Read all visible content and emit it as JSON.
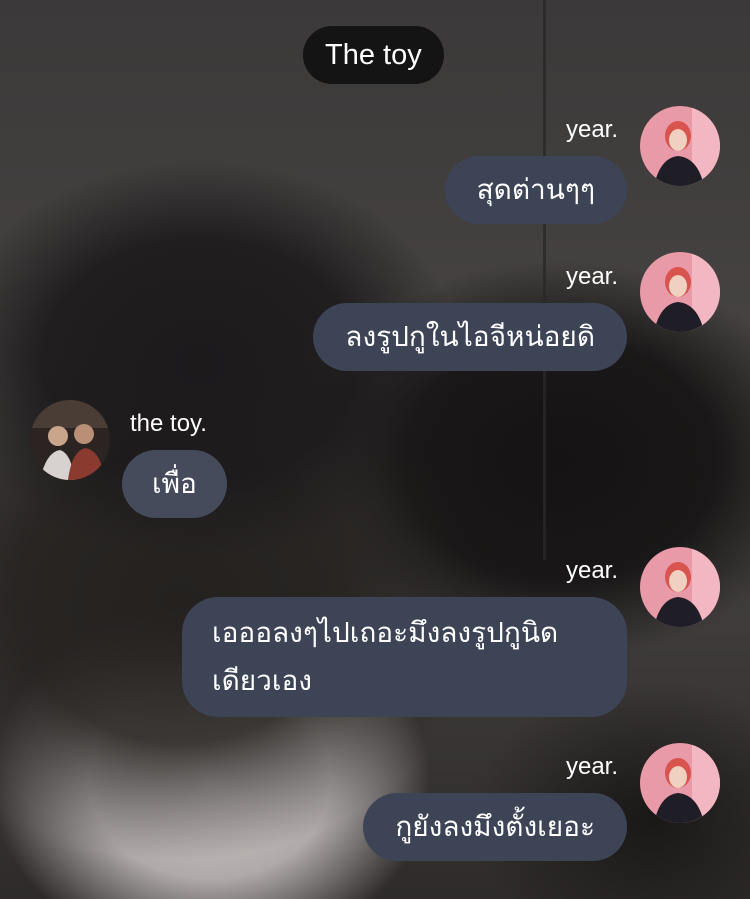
{
  "chat": {
    "title": "The toy"
  },
  "messages": [
    {
      "sender": "year.",
      "text": "สุดต่านๆๆ",
      "side": "right"
    },
    {
      "sender": "year.",
      "text": "ลงรูปกูในไอจีหน่อยดิ",
      "side": "right"
    },
    {
      "sender": "the toy.",
      "text": "เพื่อ",
      "side": "left"
    },
    {
      "sender": "year.",
      "text_line1": "เอออลงๆไปเถอะมึงลงรูปกูนิด",
      "text_line2": "เดียวเอง",
      "side": "right"
    },
    {
      "sender": "year.",
      "text": "กูยังลงมึงตั้งเยอะ",
      "side": "right"
    }
  ],
  "colors": {
    "bubble": "#3d4456",
    "header_pill": "#141414",
    "text": "#ffffff"
  },
  "icons": {
    "year_avatar": "profile-photo-pink-hair",
    "toy_avatar": "profile-photo-group"
  }
}
